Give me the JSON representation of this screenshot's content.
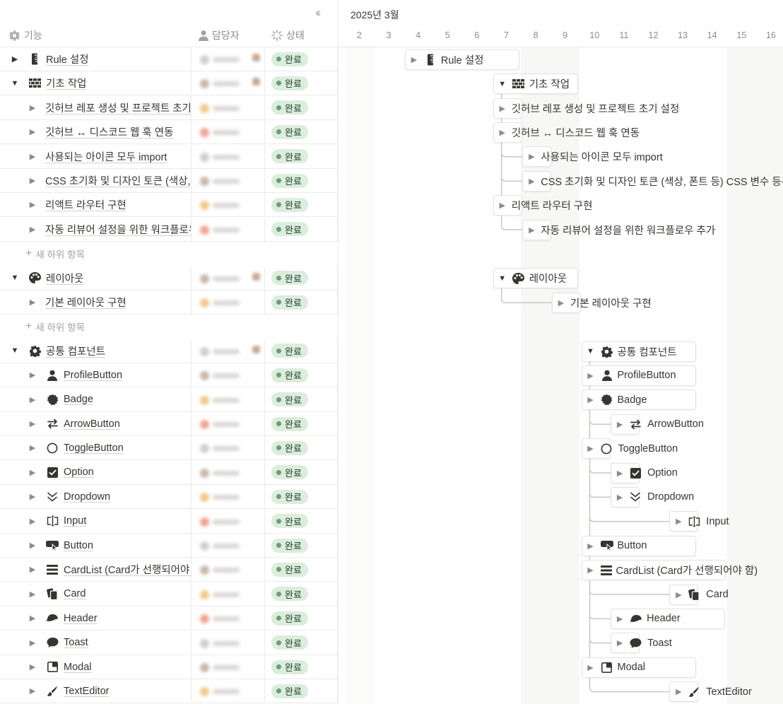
{
  "table": {
    "collapse_icon": "double-chevron-left",
    "columns": [
      {
        "label": "기능",
        "icon": "gear-icon"
      },
      {
        "label": "담당자",
        "icon": "person-icon"
      },
      {
        "label": "상태",
        "icon": "loading-icon"
      }
    ],
    "rows": [
      {
        "type": "item",
        "level": 0,
        "expanded": false,
        "icon": "ruler",
        "label": "Rule 설정",
        "status": "완료"
      },
      {
        "type": "item",
        "level": 0,
        "expanded": true,
        "icon": "bricks",
        "label": "기초 작업",
        "status": "완료"
      },
      {
        "type": "item",
        "level": 1,
        "expanded": false,
        "icon": "",
        "label": "깃허브 레포 생성 및 프로젝트 초기 설정",
        "status": "완료"
      },
      {
        "type": "item",
        "level": 1,
        "expanded": false,
        "icon": "",
        "label": "깃허브 ↔ 디스코드 웹 훅 연동",
        "status": "완료"
      },
      {
        "type": "item",
        "level": 1,
        "expanded": false,
        "icon": "",
        "label": "사용되는 아이콘 모두 import",
        "status": "완료"
      },
      {
        "type": "item",
        "level": 1,
        "expanded": false,
        "icon": "",
        "label": "CSS 초기화 및 디자인 토큰 (색상, 폰트 등) CSS 변수 등록",
        "status": "완료"
      },
      {
        "type": "item",
        "level": 1,
        "expanded": false,
        "icon": "",
        "label": "리액트 라우터 구현",
        "status": "완료"
      },
      {
        "type": "item",
        "level": 1,
        "expanded": false,
        "icon": "",
        "label": "자동 리뷰어 설정을 위한 워크플로우 추가",
        "status": "완료"
      },
      {
        "type": "new",
        "label": "새 하위 항목"
      },
      {
        "type": "item",
        "level": 0,
        "expanded": true,
        "icon": "palette",
        "label": "레이아웃",
        "status": "완료"
      },
      {
        "type": "item",
        "level": 1,
        "expanded": false,
        "icon": "",
        "label": "기본 레이아웃 구현",
        "status": "완료"
      },
      {
        "type": "new",
        "label": "새 하위 항목"
      },
      {
        "type": "item",
        "level": 0,
        "expanded": true,
        "icon": "gear",
        "label": "공통 컴포넌트",
        "status": "완료"
      },
      {
        "type": "item",
        "level": 1,
        "expanded": false,
        "icon": "person",
        "label": "ProfileButton",
        "status": "완료"
      },
      {
        "type": "item",
        "level": 1,
        "expanded": false,
        "icon": "badge",
        "label": "Badge",
        "status": "완료"
      },
      {
        "type": "item",
        "level": 1,
        "expanded": false,
        "icon": "arrows",
        "label": "ArrowButton",
        "status": "완료"
      },
      {
        "type": "item",
        "level": 1,
        "expanded": false,
        "icon": "circle",
        "label": "ToggleButton",
        "status": "완료"
      },
      {
        "type": "item",
        "level": 1,
        "expanded": false,
        "icon": "checkbox",
        "label": "Option",
        "status": "완료"
      },
      {
        "type": "item",
        "level": 1,
        "expanded": false,
        "icon": "chevrons-down",
        "label": "Dropdown",
        "status": "완료"
      },
      {
        "type": "item",
        "level": 1,
        "expanded": false,
        "icon": "input",
        "label": "Input",
        "status": "완료"
      },
      {
        "type": "item",
        "level": 1,
        "expanded": false,
        "icon": "pointer",
        "label": "Button",
        "status": "완료"
      },
      {
        "type": "item",
        "level": 1,
        "expanded": false,
        "icon": "list",
        "label": "CardList (Card가 선행되어야 함)",
        "status": "완료"
      },
      {
        "type": "item",
        "level": 1,
        "expanded": false,
        "icon": "cards",
        "label": "Card",
        "status": "완료"
      },
      {
        "type": "item",
        "level": 1,
        "expanded": false,
        "icon": "cap",
        "label": "Header",
        "status": "완료"
      },
      {
        "type": "item",
        "level": 1,
        "expanded": false,
        "icon": "bubble",
        "label": "Toast",
        "status": "완료"
      },
      {
        "type": "item",
        "level": 1,
        "expanded": false,
        "icon": "modal",
        "label": "Modal",
        "status": "완료"
      },
      {
        "type": "item",
        "level": 1,
        "expanded": false,
        "icon": "brush",
        "label": "TextEditor",
        "status": "완료"
      }
    ]
  },
  "timeline": {
    "month": "2025년 3월",
    "days": [
      "2",
      "3",
      "4",
      "5",
      "6",
      "7",
      "8",
      "9",
      "10",
      "11",
      "12",
      "13",
      "14",
      "15",
      "16"
    ],
    "weekend_days": [
      "8",
      "9",
      "15",
      "16"
    ],
    "bars": [
      {
        "row": 0,
        "start": "4",
        "end": "7",
        "label": "Rule 설정",
        "icon": "ruler",
        "expanded": false,
        "style": "bar"
      },
      {
        "row": 1,
        "start": "7",
        "end": "9",
        "label": "기초 작업",
        "icon": "bricks",
        "expanded": true,
        "style": "bar"
      },
      {
        "row": 2,
        "start": "7",
        "end": "7",
        "label": "깃허브 레포 생성 및 프로젝트 초기 설정",
        "icon": "",
        "expanded": false,
        "style": "label"
      },
      {
        "row": 3,
        "start": "7",
        "end": "7",
        "label": "깃허브 ↔ 디스코드 웹 훅 연동",
        "icon": "",
        "expanded": false,
        "style": "label"
      },
      {
        "row": 4,
        "start": "8",
        "end": "8",
        "label": "사용되는 아이콘 모두 import",
        "icon": "",
        "expanded": false,
        "style": "label"
      },
      {
        "row": 5,
        "start": "8",
        "end": "8",
        "label": "CSS 초기화 및 디자인 토큰 (색상, 폰트 등) CSS 변수 등록",
        "icon": "",
        "expanded": false,
        "style": "label"
      },
      {
        "row": 6,
        "start": "7",
        "end": "7",
        "label": "리액트 라우터 구현",
        "icon": "",
        "expanded": false,
        "style": "label"
      },
      {
        "row": 7,
        "start": "8",
        "end": "8",
        "label": "자동 리뷰어 설정을 위한 워크플로우 추가",
        "icon": "",
        "expanded": false,
        "style": "label"
      },
      {
        "row": 9,
        "start": "7",
        "end": "9",
        "label": "레이아웃",
        "icon": "palette",
        "expanded": true,
        "style": "bar"
      },
      {
        "row": 10,
        "start": "9",
        "end": "9",
        "label": "기본 레이아웃 구현",
        "icon": "",
        "expanded": false,
        "style": "label"
      },
      {
        "row": 12,
        "start": "10",
        "end": "13",
        "label": "공통 컴포넌트",
        "icon": "gear",
        "expanded": true,
        "style": "bar"
      },
      {
        "row": 13,
        "start": "10",
        "end": "13",
        "label": "ProfileButton",
        "icon": "person",
        "expanded": false,
        "style": "bar"
      },
      {
        "row": 14,
        "start": "10",
        "end": "13",
        "label": "Badge",
        "icon": "badge",
        "expanded": false,
        "style": "bar"
      },
      {
        "row": 15,
        "start": "11",
        "end": "11",
        "label": "ArrowButton",
        "icon": "arrows",
        "expanded": false,
        "style": "label"
      },
      {
        "row": 16,
        "start": "10",
        "end": "10",
        "label": "ToggleButton",
        "icon": "circle",
        "expanded": false,
        "style": "label"
      },
      {
        "row": 17,
        "start": "11",
        "end": "11",
        "label": "Option",
        "icon": "checkbox",
        "expanded": false,
        "style": "label"
      },
      {
        "row": 18,
        "start": "11",
        "end": "11",
        "label": "Dropdown",
        "icon": "chevrons-down",
        "expanded": false,
        "style": "label"
      },
      {
        "row": 19,
        "start": "13",
        "end": "13",
        "label": "Input",
        "icon": "input",
        "expanded": false,
        "style": "label"
      },
      {
        "row": 20,
        "start": "10",
        "end": "13",
        "label": "Button",
        "icon": "pointer",
        "expanded": false,
        "style": "bar"
      },
      {
        "row": 21,
        "start": "10",
        "end": "14",
        "label": "CardList (Card가 선행되어야 함)",
        "icon": "list",
        "expanded": false,
        "style": "bar"
      },
      {
        "row": 22,
        "start": "13",
        "end": "13",
        "label": "Card",
        "icon": "cards",
        "expanded": false,
        "style": "label"
      },
      {
        "row": 23,
        "start": "11",
        "end": "14",
        "label": "Header",
        "icon": "cap",
        "expanded": false,
        "style": "bar"
      },
      {
        "row": 24,
        "start": "11",
        "end": "11",
        "label": "Toast",
        "icon": "bubble",
        "expanded": false,
        "style": "label"
      },
      {
        "row": 25,
        "start": "10",
        "end": "13",
        "label": "Modal",
        "icon": "modal",
        "expanded": false,
        "style": "bar"
      },
      {
        "row": 26,
        "start": "13",
        "end": "13",
        "label": "TextEditor",
        "icon": "brush",
        "expanded": false,
        "style": "label"
      }
    ]
  },
  "colors": {
    "badge_bg": "#dbeddb",
    "badge_dot": "#6c9b7d",
    "weekend_bg": "#f7f7f5",
    "border": "#ebebea",
    "text": "#37352f",
    "muted": "#8c8b87"
  }
}
